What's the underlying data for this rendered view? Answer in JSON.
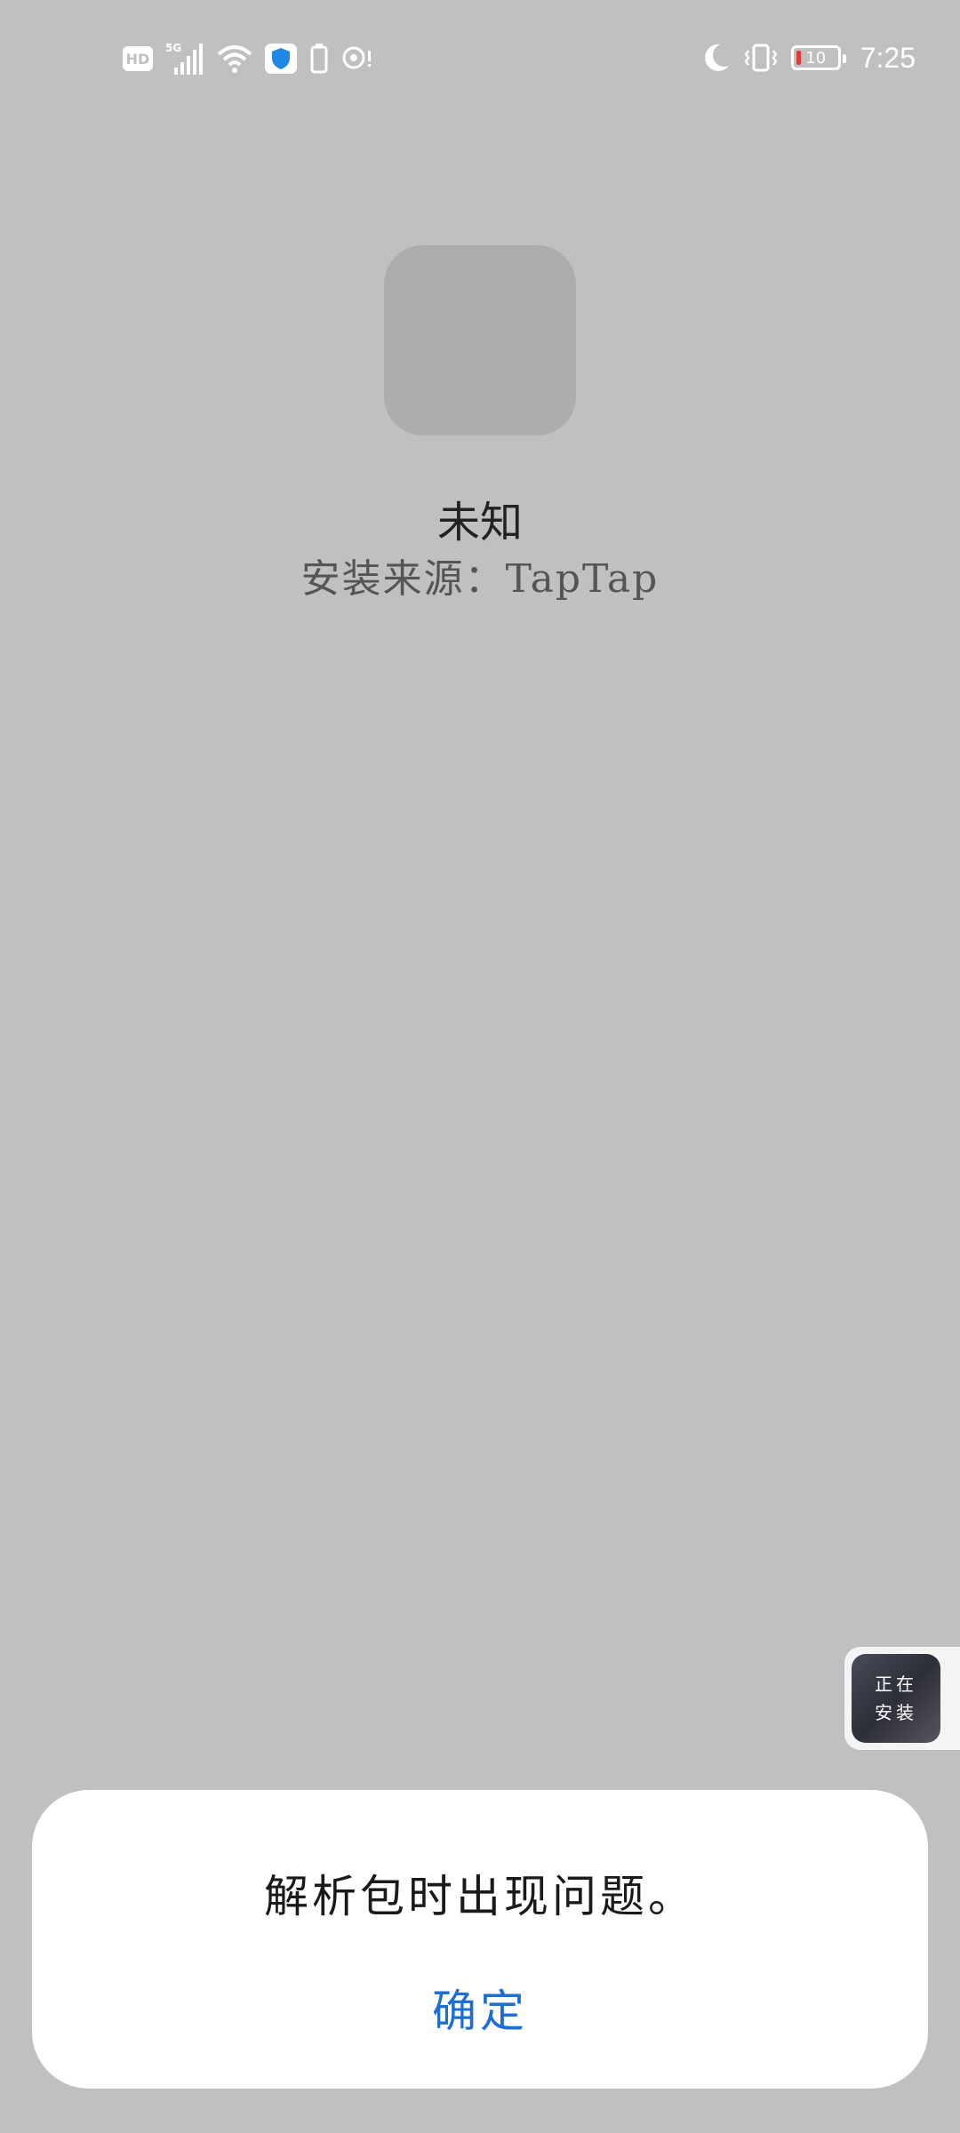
{
  "status_bar": {
    "hd_label": "HD",
    "network_label": "5G",
    "battery_level": "10",
    "time": "7:25"
  },
  "app": {
    "name": "未知",
    "source": "安装来源：TapTap"
  },
  "floating_badge": {
    "line1": "正在",
    "line2": "安装"
  },
  "dialog": {
    "message": "解析包时出现问题。",
    "confirm_label": "确定"
  },
  "colors": {
    "background": "#bfc0c2",
    "accent": "#1f6fd1",
    "battery_low": "#e53935"
  }
}
